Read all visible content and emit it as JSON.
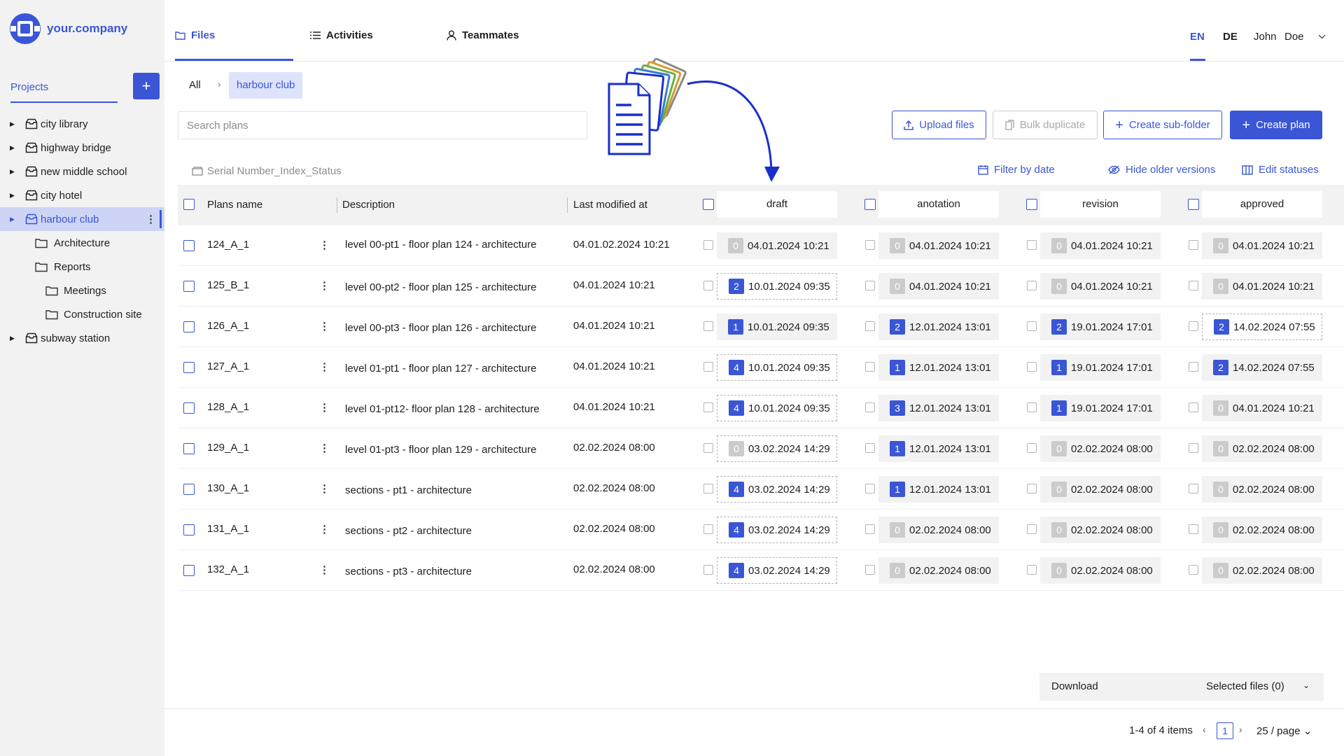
{
  "brand": {
    "name": "your.company",
    "color": "#3a56d6"
  },
  "sidebar": {
    "projects_label": "Projects",
    "add_label": "+",
    "tree": [
      {
        "label": "city library",
        "type": "project",
        "level": 0,
        "expandable": true
      },
      {
        "label": "highway bridge",
        "type": "project",
        "level": 0,
        "expandable": true
      },
      {
        "label": "new middle school",
        "type": "project",
        "level": 0,
        "expandable": true
      },
      {
        "label": "city hotel",
        "type": "project",
        "level": 0,
        "expandable": true
      },
      {
        "label": "harbour club",
        "type": "project",
        "level": 0,
        "expandable": true,
        "active": true
      },
      {
        "label": "Architecture",
        "type": "folder",
        "level": 1
      },
      {
        "label": "Reports",
        "type": "folder",
        "level": 1
      },
      {
        "label": "Meetings",
        "type": "folder",
        "level": 2
      },
      {
        "label": "Construction site",
        "type": "folder",
        "level": 2
      },
      {
        "label": "subway station",
        "type": "project",
        "level": 0,
        "expandable": true
      }
    ]
  },
  "nav": {
    "tabs": [
      {
        "label": "Files",
        "icon": "folder-icon",
        "active": true
      },
      {
        "label": "Activities",
        "icon": "list-icon"
      },
      {
        "label": "Teammates",
        "icon": "user-icon"
      }
    ],
    "lang_en": "EN",
    "lang_de": "DE",
    "user_first": "John",
    "user_last": "Doe"
  },
  "breadcrumb": {
    "root": "All",
    "separator": "›",
    "current": "harbour club"
  },
  "search": {
    "placeholder": "Search plans",
    "value": ""
  },
  "actions": {
    "upload": "Upload files",
    "bulk_duplicate": "Bulk duplicate",
    "create_subfolder": "Create sub-folder",
    "create_plan": "Create plan"
  },
  "toolbar": {
    "serial_format": "Serial Number_Index_Status",
    "filter_by_date": "Filter by date",
    "hide_older": "Hide older versions",
    "edit_statuses": "Edit statuses"
  },
  "table": {
    "headers": {
      "name": "Plans name",
      "description": "Description",
      "modified": "Last modified at",
      "statuses": [
        "draft",
        "anotation",
        "revision",
        "approved"
      ]
    },
    "rows": [
      {
        "name": "124_A_1",
        "description": "level 00-pt1 - floor plan 124 - architecture",
        "modified": "04.01.02.2024 10:21",
        "statuses": [
          {
            "count": "0",
            "date": "04.01.2024 10:21"
          },
          {
            "count": "0",
            "date": "04.01.2024 10:21"
          },
          {
            "count": "0",
            "date": "04.01.2024 10:21"
          },
          {
            "count": "0",
            "date": "04.01.2024 10:21"
          }
        ]
      },
      {
        "name": "125_B_1",
        "description": "level 00-pt2 - floor plan 125 - architecture",
        "modified": "04.01.2024 10:21",
        "statuses": [
          {
            "count": "2",
            "date": "10.01.2024 09:35",
            "current": true
          },
          {
            "count": "0",
            "date": "04.01.2024 10:21"
          },
          {
            "count": "0",
            "date": "04.01.2024 10:21"
          },
          {
            "count": "0",
            "date": "04.01.2024 10:21"
          }
        ]
      },
      {
        "name": "126_A_1",
        "description": "level 00-pt3 - floor plan 126 - architecture",
        "modified": "04.01.2024 10:21",
        "statuses": [
          {
            "count": "1",
            "date": "10.01.2024 09:35"
          },
          {
            "count": "2",
            "date": "12.01.2024 13:01"
          },
          {
            "count": "2",
            "date": "19.01.2024 17:01"
          },
          {
            "count": "2",
            "date": "14.02.2024 07:55",
            "current": true
          }
        ]
      },
      {
        "name": "127_A_1",
        "description": "level 01-pt1 - floor plan 127 - architecture",
        "modified": "04.01.2024 10:21",
        "statuses": [
          {
            "count": "4",
            "date": "10.01.2024 09:35",
            "current": true
          },
          {
            "count": "1",
            "date": "12.01.2024 13:01"
          },
          {
            "count": "1",
            "date": "19.01.2024 17:01"
          },
          {
            "count": "2",
            "date": "14.02.2024 07:55"
          }
        ]
      },
      {
        "name": "128_A_1",
        "description": "level 01-pt12- floor plan 128 - architecture",
        "modified": "04.01.2024 10:21",
        "statuses": [
          {
            "count": "4",
            "date": "10.01.2024 09:35",
            "current": true
          },
          {
            "count": "3",
            "date": "12.01.2024 13:01"
          },
          {
            "count": "1",
            "date": "19.01.2024 17:01"
          },
          {
            "count": "0",
            "date": "04.01.2024 10:21"
          }
        ]
      },
      {
        "name": "129_A_1",
        "description": "level 01-pt3 - floor plan 129 - architecture",
        "modified": "02.02.2024 08:00",
        "statuses": [
          {
            "count": "0",
            "date": "03.02.2024 14:29",
            "current": true
          },
          {
            "count": "1",
            "date": "12.01.2024 13:01"
          },
          {
            "count": "0",
            "date": "02.02.2024 08:00"
          },
          {
            "count": "0",
            "date": "02.02.2024 08:00"
          }
        ]
      },
      {
        "name": "130_A_1",
        "description": "sections - pt1 - architecture",
        "modified": "02.02.2024 08:00",
        "statuses": [
          {
            "count": "4",
            "date": "03.02.2024 14:29",
            "current": true
          },
          {
            "count": "1",
            "date": "12.01.2024 13:01"
          },
          {
            "count": "0",
            "date": "02.02.2024 08:00"
          },
          {
            "count": "0",
            "date": "02.02.2024 08:00"
          }
        ]
      },
      {
        "name": "131_A_1",
        "description": "sections - pt2 - architecture",
        "modified": "02.02.2024 08:00",
        "statuses": [
          {
            "count": "4",
            "date": "03.02.2024 14:29",
            "current": true
          },
          {
            "count": "0",
            "date": "02.02.2024 08:00"
          },
          {
            "count": "0",
            "date": "02.02.2024 08:00"
          },
          {
            "count": "0",
            "date": "02.02.2024 08:00"
          }
        ]
      },
      {
        "name": "132_A_1",
        "description": "sections - pt3 - architecture",
        "modified": "02.02.2024 08:00",
        "statuses": [
          {
            "count": "4",
            "date": "03.02.2024 14:29",
            "current": true
          },
          {
            "count": "0",
            "date": "02.02.2024 08:00"
          },
          {
            "count": "0",
            "date": "02.02.2024 08:00"
          },
          {
            "count": "0",
            "date": "02.02.2024 08:00"
          }
        ]
      }
    ]
  },
  "download": {
    "label": "Download",
    "selected": "Selected files (0)"
  },
  "pagination": {
    "info": "1-4 of 4 items",
    "page": "1",
    "page_size": "25 / page"
  }
}
